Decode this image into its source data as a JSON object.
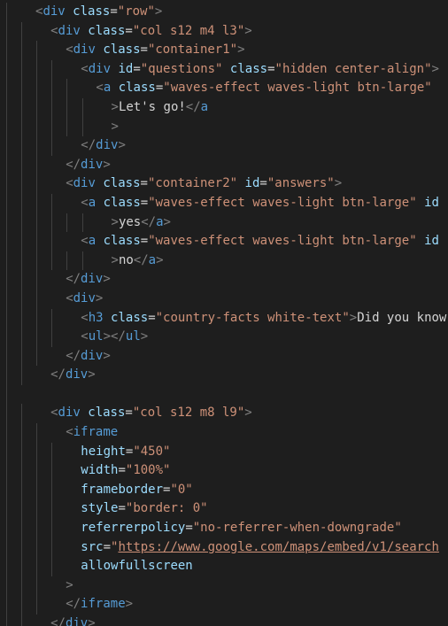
{
  "editor": {
    "colors": {
      "background": "#1e1e1e",
      "punct": "#808080",
      "tag": "#569cd6",
      "attr": "#9cdcfe",
      "string": "#ce9178",
      "text": "#d4d4d4",
      "guide": "#404040"
    },
    "lines": [
      {
        "indent": 1,
        "tokens": [
          {
            "c": "punct",
            "v": "<"
          },
          {
            "c": "tag",
            "v": "div"
          },
          {
            "c": "text",
            "v": " "
          },
          {
            "c": "attr",
            "v": "class"
          },
          {
            "c": "eq",
            "v": "="
          },
          {
            "c": "str",
            "v": "\"row\""
          },
          {
            "c": "punct",
            "v": ">"
          }
        ]
      },
      {
        "indent": 2,
        "tokens": [
          {
            "c": "punct",
            "v": "<"
          },
          {
            "c": "tag",
            "v": "div"
          },
          {
            "c": "text",
            "v": " "
          },
          {
            "c": "attr",
            "v": "class"
          },
          {
            "c": "eq",
            "v": "="
          },
          {
            "c": "str",
            "v": "\"col s12 m4 l3\""
          },
          {
            "c": "punct",
            "v": ">"
          }
        ]
      },
      {
        "indent": 3,
        "tokens": [
          {
            "c": "punct",
            "v": "<"
          },
          {
            "c": "tag",
            "v": "div"
          },
          {
            "c": "text",
            "v": " "
          },
          {
            "c": "attr",
            "v": "class"
          },
          {
            "c": "eq",
            "v": "="
          },
          {
            "c": "str",
            "v": "\"container1\""
          },
          {
            "c": "punct",
            "v": ">"
          }
        ]
      },
      {
        "indent": 4,
        "tokens": [
          {
            "c": "punct",
            "v": "<"
          },
          {
            "c": "tag",
            "v": "div"
          },
          {
            "c": "text",
            "v": " "
          },
          {
            "c": "attr",
            "v": "id"
          },
          {
            "c": "eq",
            "v": "="
          },
          {
            "c": "str",
            "v": "\"questions\""
          },
          {
            "c": "text",
            "v": " "
          },
          {
            "c": "attr",
            "v": "class"
          },
          {
            "c": "eq",
            "v": "="
          },
          {
            "c": "str",
            "v": "\"hidden center-align\""
          },
          {
            "c": "punct",
            "v": ">"
          }
        ]
      },
      {
        "indent": 5,
        "tokens": [
          {
            "c": "punct",
            "v": "<"
          },
          {
            "c": "tag",
            "v": "a"
          },
          {
            "c": "text",
            "v": " "
          },
          {
            "c": "attr",
            "v": "class"
          },
          {
            "c": "eq",
            "v": "="
          },
          {
            "c": "str",
            "v": "\"waves-effect waves-light btn-large\""
          }
        ]
      },
      {
        "indent": 6,
        "tokens": [
          {
            "c": "punct",
            "v": ">"
          },
          {
            "c": "text",
            "v": "Let's go!"
          },
          {
            "c": "punct",
            "v": "</"
          },
          {
            "c": "tag",
            "v": "a"
          }
        ]
      },
      {
        "indent": 6,
        "tokens": [
          {
            "c": "punct",
            "v": ">"
          }
        ]
      },
      {
        "indent": 4,
        "tokens": [
          {
            "c": "punct",
            "v": "</"
          },
          {
            "c": "tag",
            "v": "div"
          },
          {
            "c": "punct",
            "v": ">"
          }
        ]
      },
      {
        "indent": 3,
        "tokens": [
          {
            "c": "punct",
            "v": "</"
          },
          {
            "c": "tag",
            "v": "div"
          },
          {
            "c": "punct",
            "v": ">"
          }
        ]
      },
      {
        "indent": 3,
        "tokens": [
          {
            "c": "punct",
            "v": "<"
          },
          {
            "c": "tag",
            "v": "div"
          },
          {
            "c": "text",
            "v": " "
          },
          {
            "c": "attr",
            "v": "class"
          },
          {
            "c": "eq",
            "v": "="
          },
          {
            "c": "str",
            "v": "\"container2\""
          },
          {
            "c": "text",
            "v": " "
          },
          {
            "c": "attr",
            "v": "id"
          },
          {
            "c": "eq",
            "v": "="
          },
          {
            "c": "str",
            "v": "\"answers\""
          },
          {
            "c": "punct",
            "v": ">"
          }
        ]
      },
      {
        "indent": 4,
        "tokens": [
          {
            "c": "punct",
            "v": "<"
          },
          {
            "c": "tag",
            "v": "a"
          },
          {
            "c": "text",
            "v": " "
          },
          {
            "c": "attr",
            "v": "class"
          },
          {
            "c": "eq",
            "v": "="
          },
          {
            "c": "str",
            "v": "\"waves-effect waves-light btn-large\""
          },
          {
            "c": "text",
            "v": " "
          },
          {
            "c": "attr",
            "v": "id"
          }
        ]
      },
      {
        "indent": 6,
        "tokens": [
          {
            "c": "punct",
            "v": ">"
          },
          {
            "c": "text",
            "v": "yes"
          },
          {
            "c": "punct",
            "v": "</"
          },
          {
            "c": "tag",
            "v": "a"
          },
          {
            "c": "punct",
            "v": ">"
          }
        ]
      },
      {
        "indent": 4,
        "tokens": [
          {
            "c": "punct",
            "v": "<"
          },
          {
            "c": "tag",
            "v": "a"
          },
          {
            "c": "text",
            "v": " "
          },
          {
            "c": "attr",
            "v": "class"
          },
          {
            "c": "eq",
            "v": "="
          },
          {
            "c": "str",
            "v": "\"waves-effect waves-light btn-large\""
          },
          {
            "c": "text",
            "v": " "
          },
          {
            "c": "attr",
            "v": "id"
          }
        ]
      },
      {
        "indent": 6,
        "tokens": [
          {
            "c": "punct",
            "v": ">"
          },
          {
            "c": "text",
            "v": "no"
          },
          {
            "c": "punct",
            "v": "</"
          },
          {
            "c": "tag",
            "v": "a"
          },
          {
            "c": "punct",
            "v": ">"
          }
        ]
      },
      {
        "indent": 3,
        "tokens": [
          {
            "c": "punct",
            "v": "</"
          },
          {
            "c": "tag",
            "v": "div"
          },
          {
            "c": "punct",
            "v": ">"
          }
        ]
      },
      {
        "indent": 3,
        "tokens": [
          {
            "c": "punct",
            "v": "<"
          },
          {
            "c": "tag",
            "v": "div"
          },
          {
            "c": "punct",
            "v": ">"
          }
        ]
      },
      {
        "indent": 4,
        "tokens": [
          {
            "c": "punct",
            "v": "<"
          },
          {
            "c": "tag",
            "v": "h3"
          },
          {
            "c": "text",
            "v": " "
          },
          {
            "c": "attr",
            "v": "class"
          },
          {
            "c": "eq",
            "v": "="
          },
          {
            "c": "str",
            "v": "\"country-facts white-text\""
          },
          {
            "c": "punct",
            "v": ">"
          },
          {
            "c": "text",
            "v": "Did you know"
          }
        ]
      },
      {
        "indent": 4,
        "tokens": [
          {
            "c": "punct",
            "v": "<"
          },
          {
            "c": "tag",
            "v": "ul"
          },
          {
            "c": "punct",
            "v": "></"
          },
          {
            "c": "tag",
            "v": "ul"
          },
          {
            "c": "punct",
            "v": ">"
          }
        ]
      },
      {
        "indent": 3,
        "tokens": [
          {
            "c": "punct",
            "v": "</"
          },
          {
            "c": "tag",
            "v": "div"
          },
          {
            "c": "punct",
            "v": ">"
          }
        ]
      },
      {
        "indent": 2,
        "tokens": [
          {
            "c": "punct",
            "v": "</"
          },
          {
            "c": "tag",
            "v": "div"
          },
          {
            "c": "punct",
            "v": ">"
          }
        ]
      },
      {
        "indent": 1,
        "tokens": []
      },
      {
        "indent": 2,
        "tokens": [
          {
            "c": "punct",
            "v": "<"
          },
          {
            "c": "tag",
            "v": "div"
          },
          {
            "c": "text",
            "v": " "
          },
          {
            "c": "attr",
            "v": "class"
          },
          {
            "c": "eq",
            "v": "="
          },
          {
            "c": "str",
            "v": "\"col s12 m8 l9\""
          },
          {
            "c": "punct",
            "v": ">"
          }
        ]
      },
      {
        "indent": 3,
        "tokens": [
          {
            "c": "punct",
            "v": "<"
          },
          {
            "c": "tag",
            "v": "iframe"
          }
        ]
      },
      {
        "indent": 4,
        "tokens": [
          {
            "c": "attr",
            "v": "height"
          },
          {
            "c": "eq",
            "v": "="
          },
          {
            "c": "str",
            "v": "\"450\""
          }
        ]
      },
      {
        "indent": 4,
        "tokens": [
          {
            "c": "attr",
            "v": "width"
          },
          {
            "c": "eq",
            "v": "="
          },
          {
            "c": "str",
            "v": "\"100%\""
          }
        ]
      },
      {
        "indent": 4,
        "tokens": [
          {
            "c": "attr",
            "v": "frameborder"
          },
          {
            "c": "eq",
            "v": "="
          },
          {
            "c": "str",
            "v": "\"0\""
          }
        ]
      },
      {
        "indent": 4,
        "tokens": [
          {
            "c": "attr",
            "v": "style"
          },
          {
            "c": "eq",
            "v": "="
          },
          {
            "c": "str",
            "v": "\"border: 0\""
          }
        ]
      },
      {
        "indent": 4,
        "tokens": [
          {
            "c": "attr",
            "v": "referrerpolicy"
          },
          {
            "c": "eq",
            "v": "="
          },
          {
            "c": "str",
            "v": "\"no-referrer-when-downgrade\""
          }
        ]
      },
      {
        "indent": 4,
        "tokens": [
          {
            "c": "attr",
            "v": "src"
          },
          {
            "c": "eq",
            "v": "="
          },
          {
            "c": "str",
            "v": "\""
          },
          {
            "c": "url",
            "v": "https://www.google.com/maps/embed/v1/search"
          }
        ]
      },
      {
        "indent": 4,
        "tokens": [
          {
            "c": "attr",
            "v": "allowfullscreen"
          }
        ]
      },
      {
        "indent": 3,
        "tokens": [
          {
            "c": "punct",
            "v": ">"
          }
        ]
      },
      {
        "indent": 3,
        "tokens": [
          {
            "c": "punct",
            "v": "</"
          },
          {
            "c": "tag",
            "v": "iframe"
          },
          {
            "c": "punct",
            "v": ">"
          }
        ]
      },
      {
        "indent": 2,
        "tokens": [
          {
            "c": "punct",
            "v": "</"
          },
          {
            "c": "tag",
            "v": "div"
          },
          {
            "c": "punct",
            "v": ">"
          }
        ]
      }
    ]
  }
}
